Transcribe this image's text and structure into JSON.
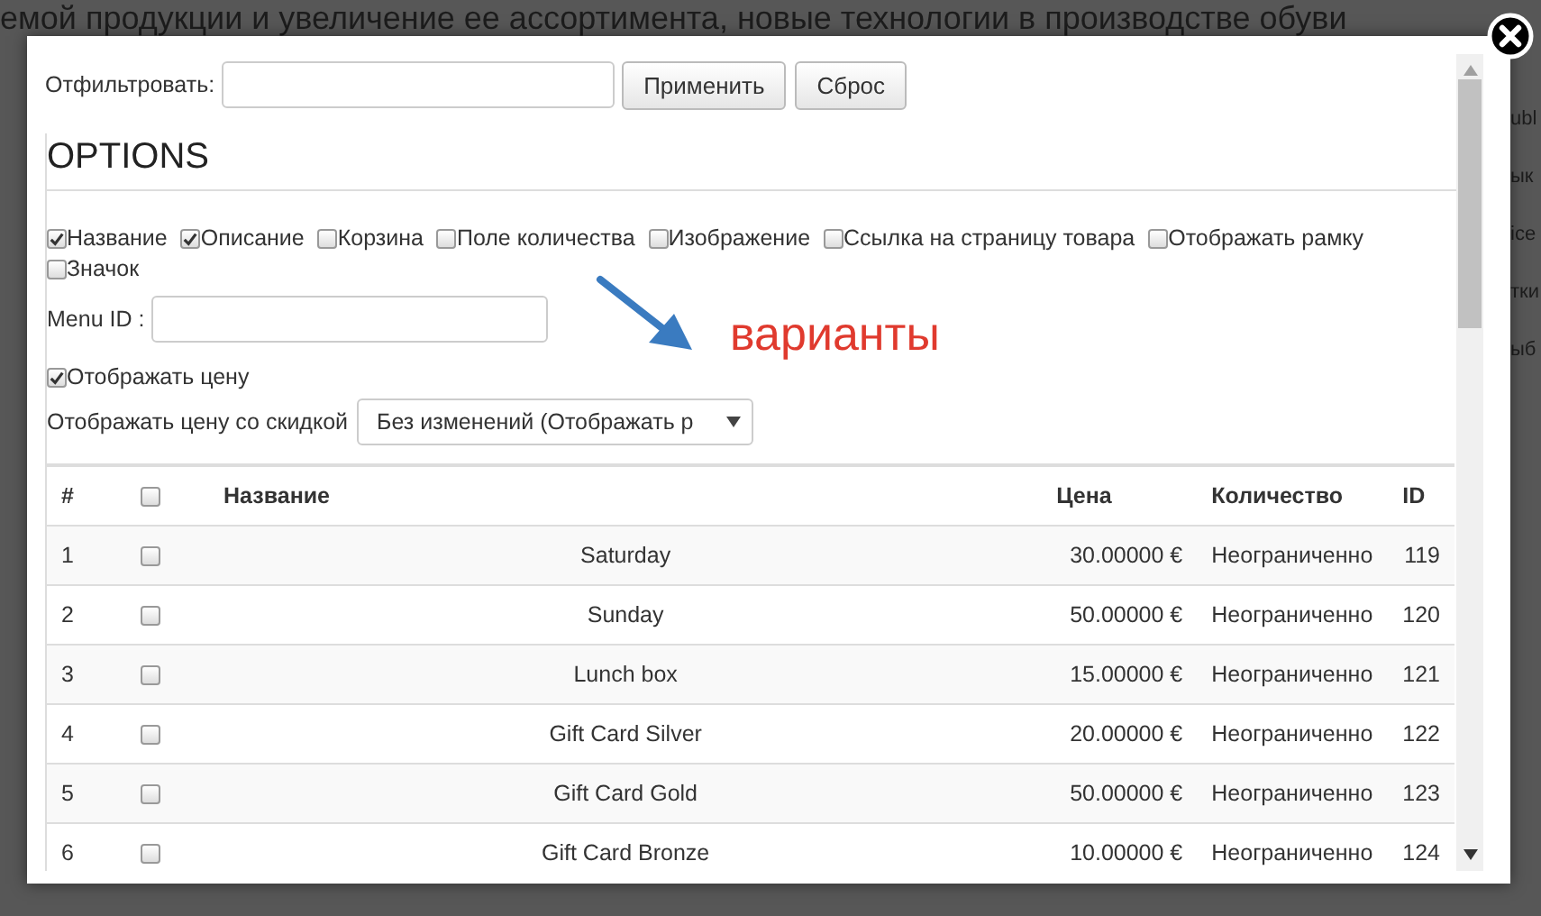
{
  "background": {
    "headline": "емой продукции и увеличение ее ассортимента, новые технологии в производстве обуви",
    "side_fragments": [
      "ubl",
      "ык",
      "ice",
      "тки",
      "ыб"
    ]
  },
  "filter": {
    "label": "Отфильтровать:",
    "buttons": [
      "Применить",
      "Сброс"
    ]
  },
  "options": {
    "title": "OPTIONS",
    "checkboxes": [
      {
        "label": "Название",
        "checked": true
      },
      {
        "label": "Описание",
        "checked": true
      },
      {
        "label": "Корзина",
        "checked": false
      },
      {
        "label": "Поле количества",
        "checked": false
      },
      {
        "label": "Изображение",
        "checked": false
      },
      {
        "label": "Ссылка на страницу товара",
        "checked": false
      },
      {
        "label": "Отображать рамку",
        "checked": false
      },
      {
        "label": "Значок",
        "checked": false
      }
    ],
    "menu_id_label": "Menu ID :",
    "show_price": {
      "label": "Отображать цену",
      "checked": true
    },
    "discount_label": "Отображать цену со скидкой",
    "discount_select": "Без изменений (Отображать р"
  },
  "annotation": {
    "text": "варианты"
  },
  "table": {
    "columns": [
      "#",
      "Название",
      "Цена",
      "Количество",
      "ID"
    ],
    "header_checked": false,
    "rows": [
      {
        "num": "1",
        "checked": false,
        "name": "Saturday",
        "price": "30.00000 €",
        "quantity": "Неограниченно",
        "id": "119"
      },
      {
        "num": "2",
        "checked": false,
        "name": "Sunday",
        "price": "50.00000 €",
        "quantity": "Неограниченно",
        "id": "120"
      },
      {
        "num": "3",
        "checked": false,
        "name": "Lunch box",
        "price": "15.00000 €",
        "quantity": "Неограниченно",
        "id": "121"
      },
      {
        "num": "4",
        "checked": false,
        "name": "Gift Card Silver",
        "price": "20.00000 €",
        "quantity": "Неограниченно",
        "id": "122"
      },
      {
        "num": "5",
        "checked": false,
        "name": "Gift Card Gold",
        "price": "50.00000 €",
        "quantity": "Неограниченно",
        "id": "123"
      },
      {
        "num": "6",
        "checked": false,
        "name": "Gift Card Bronze",
        "price": "10.00000 €",
        "quantity": "Неограниченно",
        "id": "124"
      }
    ]
  }
}
